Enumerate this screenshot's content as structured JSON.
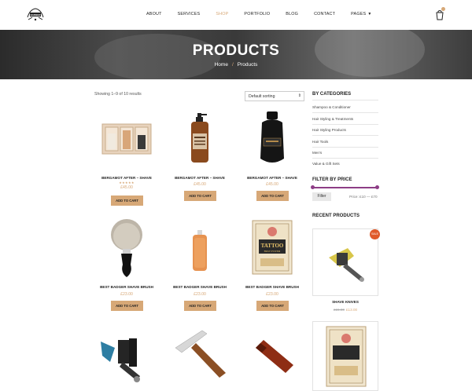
{
  "header": {
    "logo_text": "BARBER",
    "nav": [
      "ABOUT",
      "SERVICES",
      "SHOP",
      "PORTFOLIO",
      "BLOG",
      "CONTACT",
      "PAGES"
    ],
    "active_nav": "SHOP"
  },
  "hero": {
    "title": "PRODUCTS",
    "breadcrumb_home": "Home",
    "breadcrumb_sep": "/",
    "breadcrumb_current": "Products"
  },
  "shop": {
    "results_text": "Showing 1–9 of 10 results",
    "sort_selected": "Default sorting",
    "products": [
      {
        "name": "BERGAMOT AFTER – SHAVE",
        "stars": "★★★★★",
        "price": "£45.00",
        "button": "ADD TO CART"
      },
      {
        "name": "BERGAMOT AFTER – SHAVE",
        "stars": "",
        "price": "£45.00",
        "button": "ADD TO CART"
      },
      {
        "name": "BERGAMOT AFTER – SHAVE",
        "stars": "",
        "price": "£45.00",
        "button": "ADD TO CART"
      },
      {
        "name": "BEST BADGER SHAVE BRUSH",
        "stars": "",
        "price": "£23.00",
        "button": "ADD TO CART"
      },
      {
        "name": "BEST BADGER SHAVE BRUSH",
        "stars": "",
        "price": "£23.00",
        "button": "ADD TO CART"
      },
      {
        "name": "BEST BADGER SHAVE BRUSH",
        "stars": "",
        "price": "£23.00",
        "button": "ADD TO CART"
      }
    ]
  },
  "sidebar": {
    "categories_title": "BY CATEGORIES",
    "categories": [
      "Shampoo & Conditioner",
      "Hair Styling & Treatments",
      "Hair Styling Products",
      "Hair Tools",
      "Men's",
      "Value & Gift Sets"
    ],
    "filter_title": "FILTER BY PRICE",
    "filter_button": "Filter",
    "price_range": "Price: £10 — £70",
    "recent_title": "RECENT PRODUCTS",
    "sale_badge": "SALE",
    "recent": [
      {
        "name": "SHAVE KNIVES",
        "old_price": "£15.00",
        "new_price": "£13.00"
      }
    ],
    "tattoo_label_1": "TATTOO",
    "tattoo_label_2": "FIRST SYSTEM"
  },
  "colors": {
    "accent": "#d7a877",
    "slider": "#8d3d86",
    "sale": "#e05a2a"
  },
  "icons": {
    "cart": "cart-icon",
    "logo": "logo-icon",
    "pages_caret": "chevron-down-icon"
  }
}
